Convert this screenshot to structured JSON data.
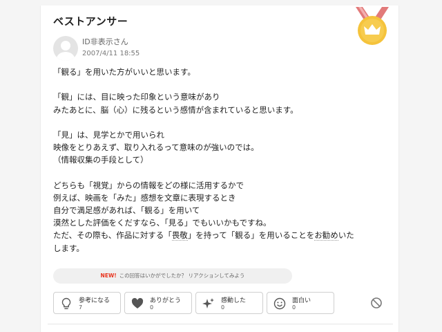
{
  "title": "ベストアンサー",
  "user": {
    "name": "ID非表示さん",
    "date": "2007/4/11 18:55"
  },
  "answer": {
    "p1": "「観る」を用いた方がいいと思います。",
    "p2a": "「観」には、目に映った印象という意味があり",
    "p2b": "みたあとに、脳（心）に残るという感情が含まれていると思います。",
    "p3a": "「見」は、見学とかで用いられ",
    "p3b": "映像をとりあえず、取り入れるって意味のが強いのでは。",
    "p3c": "（情報収集の手段として）",
    "p4a": "どちらも「視覚」からの情報をどの様に活用するかで",
    "p4b": "例えば、映画を「みた」感想を文章に表現するとき",
    "p4c": "自分で満足感があれば、「観る」を用いて",
    "p4d": "漠然とした評価をくだすなら、「見る」でもいいかもですね。",
    "p4e_pre": "ただ、その際も、作品に対する「",
    "p4e_word1": "畏敬",
    "p4e_mid": "」を持って「観る」を用いることを",
    "p4e_word2": "お勧め",
    "p4e_post": "いた",
    "p4f": "します。"
  },
  "reaction_prompt": {
    "badge": "NEW!",
    "text": "この回答はいかがでしたか？ リアクションしてみよう"
  },
  "reactions": [
    {
      "label": "参考になる",
      "count": "7",
      "icon": "lightbulb-icon"
    },
    {
      "label": "ありがとう",
      "count": "0",
      "icon": "heart-icon"
    },
    {
      "label": "感動した",
      "count": "0",
      "icon": "sparkle-icon"
    },
    {
      "label": "面白い",
      "count": "0",
      "icon": "smile-icon"
    }
  ],
  "report_icon": "prohibited-icon",
  "colors": {
    "medal_gold": "#f5c33b",
    "ribbon": "#e27a7a",
    "new_badge": "#e8321c"
  }
}
